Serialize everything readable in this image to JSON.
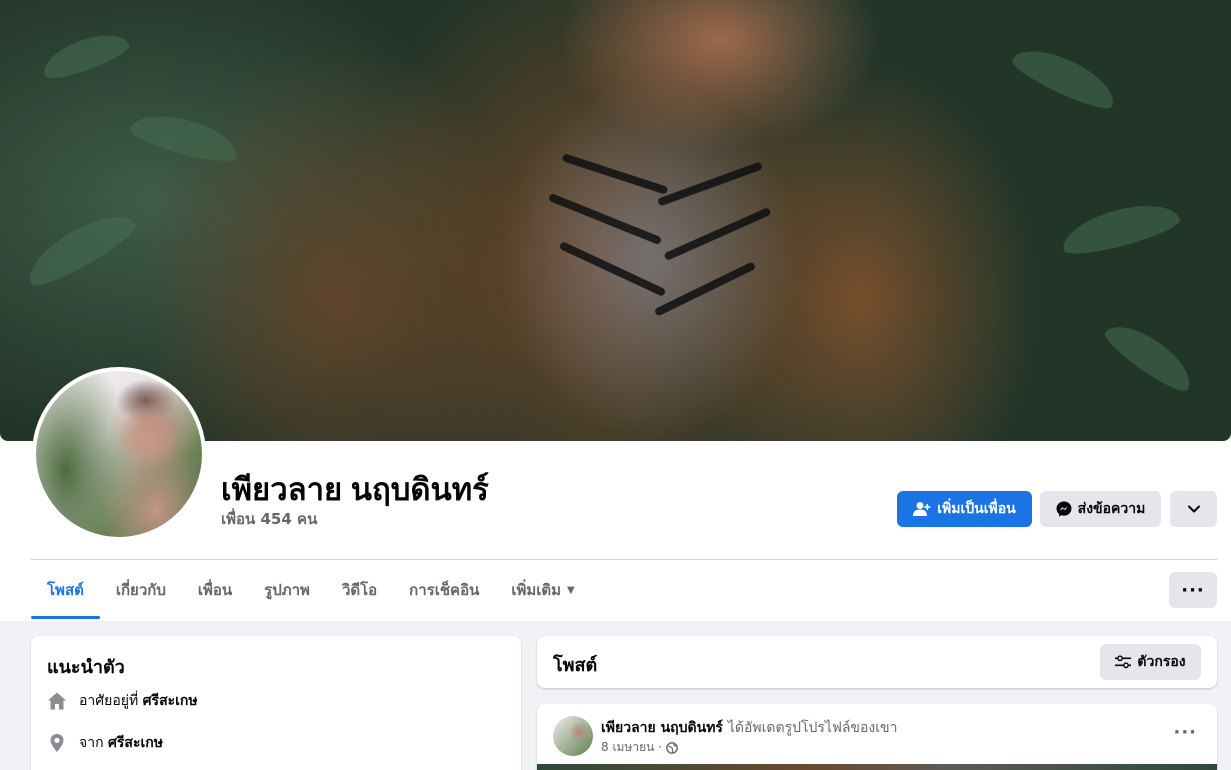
{
  "profile": {
    "name": "เพียวลาย นฤบดินทร์",
    "friends": "เพื่อน 454 คน"
  },
  "actions": {
    "add_friend": "เพิ่มเป็นเพื่อน",
    "message": "ส่งข้อความ",
    "more_icon": "chevron-down-icon"
  },
  "tabs": [
    {
      "label": "โพสต์",
      "active": true
    },
    {
      "label": "เกี่ยวกับ",
      "active": false
    },
    {
      "label": "เพื่อน",
      "active": false
    },
    {
      "label": "รูปภาพ",
      "active": false
    },
    {
      "label": "วิดีโอ",
      "active": false
    },
    {
      "label": "การเช็คอิน",
      "active": false
    },
    {
      "label": "เพิ่มเติม",
      "active": false
    }
  ],
  "intro": {
    "title": "แนะนำตัว",
    "lives_prefix": "อาศัยอยู่ที่",
    "lives_place": "ศรีสะเกษ",
    "from_prefix": "จาก",
    "from_place": "ศรีสะเกษ"
  },
  "posts": {
    "title": "โพสต์",
    "filter_label": "ตัวกรอง"
  },
  "post": {
    "author": "เพียวลาย นฤบดินทร์",
    "action": "ได้อัพเดตรูปโปรไฟล์ของเขา",
    "date": "8 เมษายน ·"
  },
  "colors": {
    "accent": "#1b74e4",
    "background": "#f0f2f5",
    "secondary_text": "#65676b"
  }
}
